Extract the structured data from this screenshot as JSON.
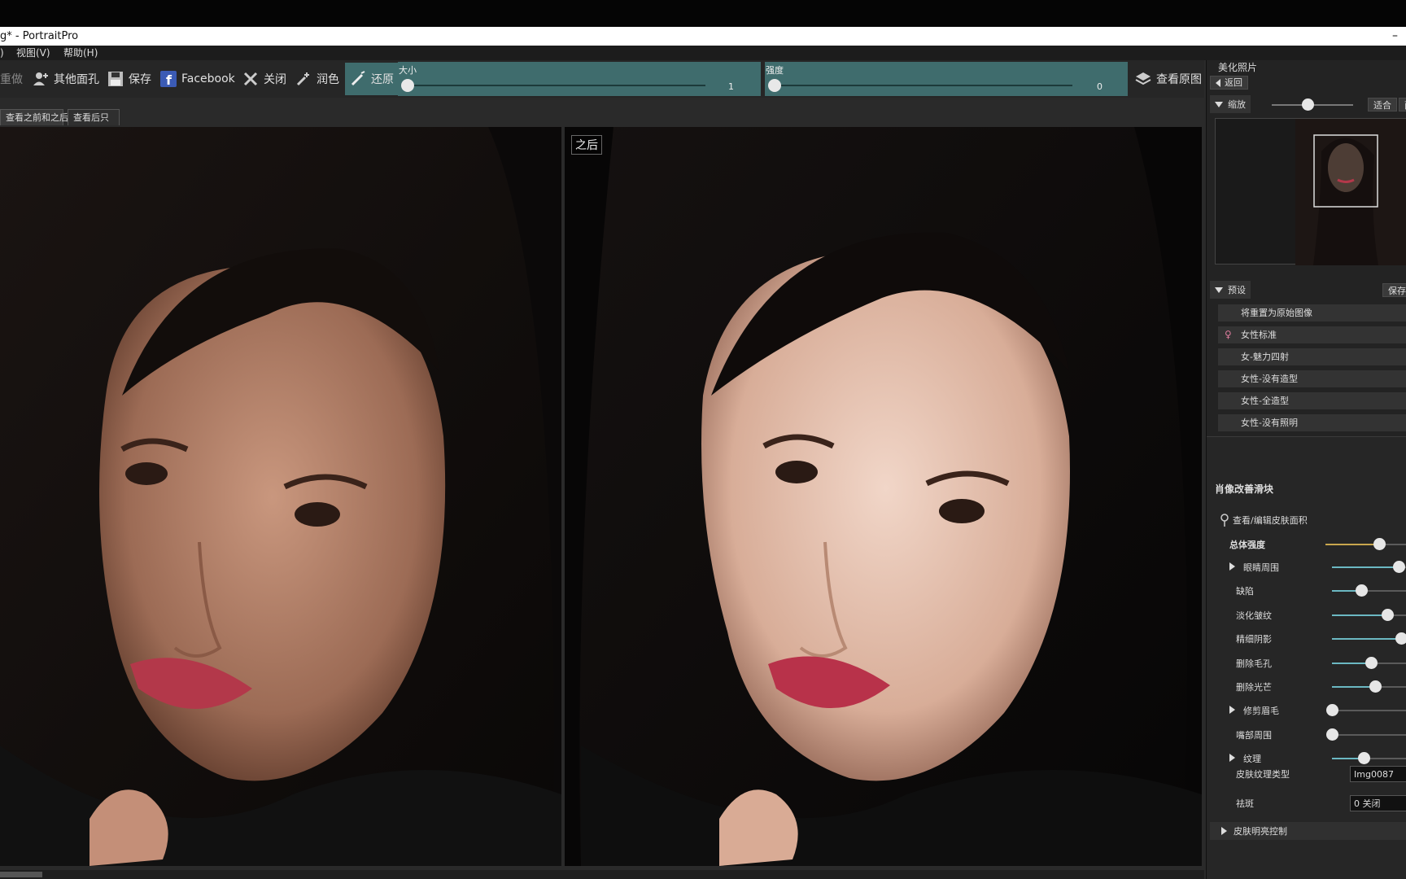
{
  "window": {
    "title": "g* - PortraitPro",
    "minimize": "–"
  },
  "menu": [
    ")",
    "视图(V)",
    "帮助(H)"
  ],
  "toolbar": {
    "redo": "重做",
    "other_faces": "其他面孔",
    "save": "保存",
    "facebook": "Facebook",
    "close": "关闭",
    "tint": "润色",
    "restore": "还原",
    "size_label": "大小",
    "size_value": "1",
    "strength_label": "强度",
    "strength_value": "0",
    "view_original": "查看原图"
  },
  "tabs": [
    "查看之前和之后",
    "查看后只"
  ],
  "viewer": {
    "after_label": "之后"
  },
  "panel": {
    "title": "美化照片",
    "back": "返回",
    "zoom": {
      "label": "缩放",
      "fit": "适合",
      "more": "面",
      "level": 0.45
    },
    "presets": {
      "label": "预设",
      "save": "保存",
      "items": [
        "将重置为原始图像",
        "女性标准",
        "女-魅力四射",
        "女性-没有造型",
        "女性-全造型",
        "女性-没有照明"
      ]
    },
    "portrait": {
      "title": "肖像改善滑块",
      "skin_area": "查看/编辑皮肤面积",
      "overall": {
        "label": "总体强度",
        "value": 0.6
      },
      "sliders": [
        {
          "label": "眼睛周围",
          "value": 0.82,
          "expandable": true
        },
        {
          "label": "缺陷",
          "value": 0.36,
          "expandable": false
        },
        {
          "label": "淡化皱纹",
          "value": 0.68,
          "expandable": false
        },
        {
          "label": "精细阴影",
          "value": 0.85,
          "expandable": false
        },
        {
          "label": "删除毛孔",
          "value": 0.48,
          "expandable": false
        },
        {
          "label": "删除光芒",
          "value": 0.53,
          "expandable": false
        },
        {
          "label": "修剪眉毛",
          "value": 0.0,
          "expandable": true
        },
        {
          "label": "嘴部周围",
          "value": 0.0,
          "expandable": false
        },
        {
          "label": "纹理",
          "value": 0.39,
          "expandable": true
        }
      ],
      "texture_type": {
        "label": "皮肤纹理类型",
        "value": "Img0087"
      },
      "freckles": {
        "label": "祛斑",
        "value": "0 关闭"
      },
      "skin_lighting": "皮肤明亮控制"
    }
  }
}
